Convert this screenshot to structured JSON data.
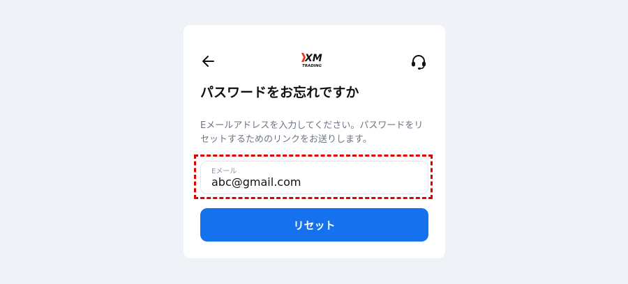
{
  "header": {
    "back_icon": "arrow-left-icon",
    "logo": {
      "brand": "XM",
      "subtitle": "TRADING",
      "accent_color": "#e8331c"
    },
    "support_icon": "headset-icon"
  },
  "form": {
    "title": "パスワードをお忘れですか",
    "description": "Eメールアドレスを入力してください。パスワードをリセットするためのリンクをお送りします。",
    "email_label": "Eメール",
    "email_value": "abc@gmail.com",
    "submit_label": "リセット"
  },
  "colors": {
    "page_background": "#eff2f7",
    "primary": "#1672ec",
    "highlight_border": "#e00000"
  }
}
